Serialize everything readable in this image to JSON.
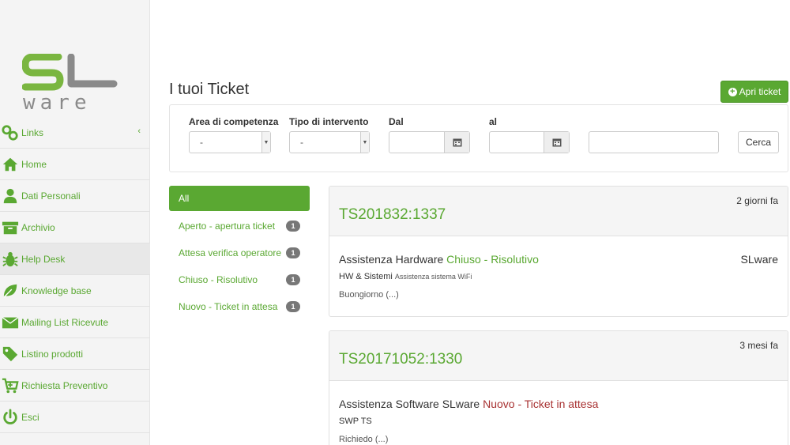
{
  "sidebar": {
    "logo_text": "SL ware",
    "colors": {
      "accent": "#5aa832",
      "logo_gray": "#8a8a8a"
    },
    "items": [
      {
        "label": "Links",
        "icon": "links-icon",
        "has_chevron": true
      },
      {
        "label": "Home",
        "icon": "home-icon"
      },
      {
        "label": "Dati Personali",
        "icon": "user-icon"
      },
      {
        "label": "Archivio",
        "icon": "archive-icon"
      },
      {
        "label": "Help Desk",
        "icon": "bug-icon",
        "active": true
      },
      {
        "label": "Knowledge base",
        "icon": "leaf-icon"
      },
      {
        "label": "Mailing List Ricevute",
        "icon": "envelope-icon"
      },
      {
        "label": "Listino prodotti",
        "icon": "tag-icon"
      },
      {
        "label": "Richiesta Preventivo",
        "icon": "cart-icon"
      },
      {
        "label": "Esci",
        "icon": "power-icon"
      }
    ],
    "chevron": "‹"
  },
  "page": {
    "title": "I tuoi Ticket",
    "new_ticket_label": "Apri ticket"
  },
  "filters": {
    "area_label": "Area di competenza",
    "area_value": "-",
    "tipo_label": "Tipo di intervento",
    "tipo_value": "-",
    "dal_label": "Dal",
    "al_label": "al",
    "search_button": "Cerca"
  },
  "status_filters": [
    {
      "label": "All",
      "active": true
    },
    {
      "label": "Aperto - apertura ticket",
      "count": "1"
    },
    {
      "label": "Attesa verifica operatore",
      "count": "1"
    },
    {
      "label": "Chiuso - Risolutivo",
      "count": "1"
    },
    {
      "label": "Nuovo - Ticket in attesa",
      "count": "1"
    }
  ],
  "tickets": [
    {
      "id": "TS201832:1337",
      "time_ago": "2 giorni fa",
      "subject": "Assistenza Hardware",
      "state": "Chiuso - Risolutivo",
      "owner": "SLware",
      "category": "HW & Sistemi",
      "subcategory": "Assistenza sistema WiFi",
      "message": "Buongiorno (...)"
    },
    {
      "id": "TS20171052:1330",
      "time_ago": "3 mesi fa",
      "subject": "Assistenza Software SLware",
      "state": "Nuovo - Ticket in attesa",
      "category": "SWP TS",
      "message": "Richiedo (...)"
    }
  ]
}
